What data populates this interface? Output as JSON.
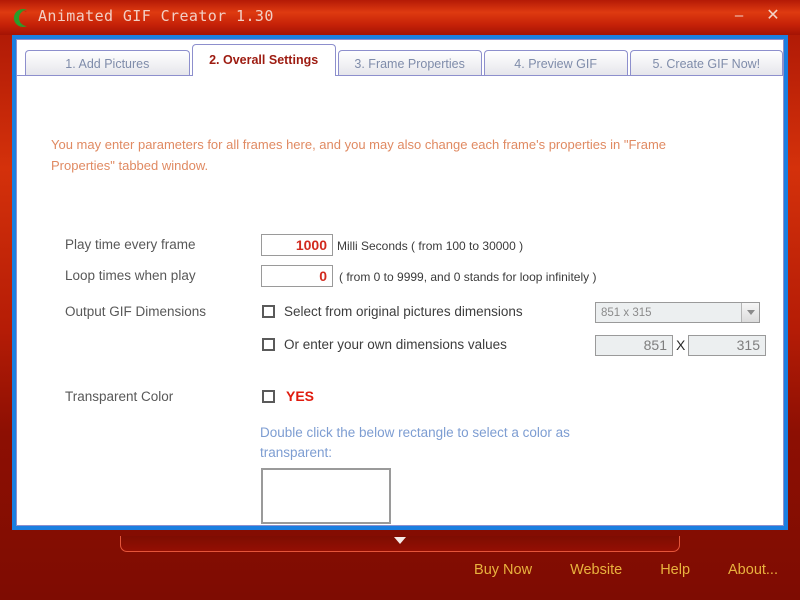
{
  "window": {
    "title": "Animated GIF Creator 1.30",
    "icon": "crescent-logo-icon",
    "minimize_label": "–",
    "close_label": "✕"
  },
  "tabs": [
    {
      "label": "1. Add Pictures",
      "active": false
    },
    {
      "label": "2. Overall Settings",
      "active": true
    },
    {
      "label": "3. Frame Properties",
      "active": false
    },
    {
      "label": "4. Preview GIF",
      "active": false
    },
    {
      "label": "5. Create GIF Now!",
      "active": false
    }
  ],
  "settings": {
    "intro_text": "You may enter parameters for all frames here, and you may also change each frame's properties in \"Frame Properties\" tabbed window.",
    "play_time": {
      "label": "Play time every frame",
      "value": "1000",
      "hint": "Milli Seconds ( from 100 to 30000 )"
    },
    "loop_times": {
      "label": "Loop times when play",
      "value": "0",
      "hint": "( from 0 to 9999, and 0 stands for loop infinitely )"
    },
    "dimensions": {
      "label": "Output GIF Dimensions",
      "option_original_label": "Select from original pictures dimensions",
      "option_original_checked": false,
      "select_value": "851 x 315",
      "option_custom_label": "Or enter your own dimensions values",
      "option_custom_checked": false,
      "width_value": "851",
      "separator": "X",
      "height_value": "315"
    },
    "transparent": {
      "label": "Transparent Color",
      "yes_label": "YES",
      "yes_checked": false,
      "note": "Double click the below rectangle to select a color as transparent:",
      "swatch_color": "#ffffff"
    }
  },
  "footer": {
    "links": [
      {
        "label": "Buy Now"
      },
      {
        "label": "Website"
      },
      {
        "label": "Help"
      },
      {
        "label": "About..."
      }
    ]
  },
  "colors": {
    "title_bar": "#d4310b",
    "window_chrome": "#8d0f03",
    "frame_blue": "#1b7fe0",
    "active_tab_text": "#9d1b10",
    "inactive_tab_text": "#7f8caa",
    "intro_text": "#e08a62",
    "input_value": "#d22a1e",
    "note_text": "#7d9dd2",
    "footer_link": "#e9b23e"
  }
}
